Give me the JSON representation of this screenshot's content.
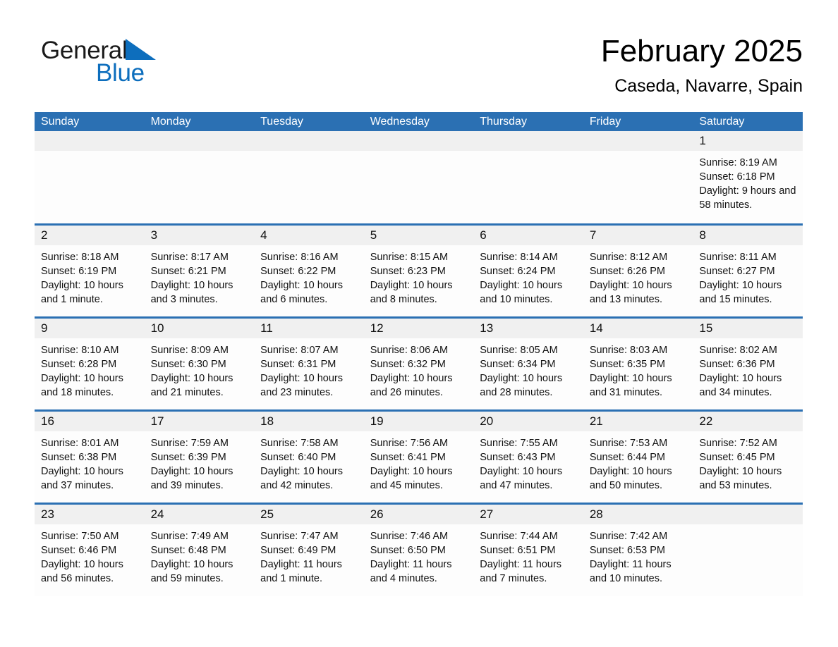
{
  "brand": {
    "word1": "General",
    "word2": "Blue",
    "flag_icon": "blue-triangle-flag",
    "accent_color": "#0d6ebd"
  },
  "header": {
    "title": "February 2025",
    "subtitle": "Caseda, Navarre, Spain"
  },
  "theme": {
    "header_blue": "#2b70b3",
    "day_band_gray": "#f0f0f0",
    "cell_white": "#fdfdfd",
    "text_black": "#111111"
  },
  "calendar": {
    "weekday_headers": [
      "Sunday",
      "Monday",
      "Tuesday",
      "Wednesday",
      "Thursday",
      "Friday",
      "Saturday"
    ],
    "weeks": [
      [
        {
          "day": "",
          "empty": true
        },
        {
          "day": "",
          "empty": true
        },
        {
          "day": "",
          "empty": true
        },
        {
          "day": "",
          "empty": true
        },
        {
          "day": "",
          "empty": true
        },
        {
          "day": "",
          "empty": true
        },
        {
          "day": "1",
          "sunrise": "Sunrise: 8:19 AM",
          "sunset": "Sunset: 6:18 PM",
          "daylight": "Daylight: 9 hours and 58 minutes."
        }
      ],
      [
        {
          "day": "2",
          "sunrise": "Sunrise: 8:18 AM",
          "sunset": "Sunset: 6:19 PM",
          "daylight": "Daylight: 10 hours and 1 minute."
        },
        {
          "day": "3",
          "sunrise": "Sunrise: 8:17 AM",
          "sunset": "Sunset: 6:21 PM",
          "daylight": "Daylight: 10 hours and 3 minutes."
        },
        {
          "day": "4",
          "sunrise": "Sunrise: 8:16 AM",
          "sunset": "Sunset: 6:22 PM",
          "daylight": "Daylight: 10 hours and 6 minutes."
        },
        {
          "day": "5",
          "sunrise": "Sunrise: 8:15 AM",
          "sunset": "Sunset: 6:23 PM",
          "daylight": "Daylight: 10 hours and 8 minutes."
        },
        {
          "day": "6",
          "sunrise": "Sunrise: 8:14 AM",
          "sunset": "Sunset: 6:24 PM",
          "daylight": "Daylight: 10 hours and 10 minutes."
        },
        {
          "day": "7",
          "sunrise": "Sunrise: 8:12 AM",
          "sunset": "Sunset: 6:26 PM",
          "daylight": "Daylight: 10 hours and 13 minutes."
        },
        {
          "day": "8",
          "sunrise": "Sunrise: 8:11 AM",
          "sunset": "Sunset: 6:27 PM",
          "daylight": "Daylight: 10 hours and 15 minutes."
        }
      ],
      [
        {
          "day": "9",
          "sunrise": "Sunrise: 8:10 AM",
          "sunset": "Sunset: 6:28 PM",
          "daylight": "Daylight: 10 hours and 18 minutes."
        },
        {
          "day": "10",
          "sunrise": "Sunrise: 8:09 AM",
          "sunset": "Sunset: 6:30 PM",
          "daylight": "Daylight: 10 hours and 21 minutes."
        },
        {
          "day": "11",
          "sunrise": "Sunrise: 8:07 AM",
          "sunset": "Sunset: 6:31 PM",
          "daylight": "Daylight: 10 hours and 23 minutes."
        },
        {
          "day": "12",
          "sunrise": "Sunrise: 8:06 AM",
          "sunset": "Sunset: 6:32 PM",
          "daylight": "Daylight: 10 hours and 26 minutes."
        },
        {
          "day": "13",
          "sunrise": "Sunrise: 8:05 AM",
          "sunset": "Sunset: 6:34 PM",
          "daylight": "Daylight: 10 hours and 28 minutes."
        },
        {
          "day": "14",
          "sunrise": "Sunrise: 8:03 AM",
          "sunset": "Sunset: 6:35 PM",
          "daylight": "Daylight: 10 hours and 31 minutes."
        },
        {
          "day": "15",
          "sunrise": "Sunrise: 8:02 AM",
          "sunset": "Sunset: 6:36 PM",
          "daylight": "Daylight: 10 hours and 34 minutes."
        }
      ],
      [
        {
          "day": "16",
          "sunrise": "Sunrise: 8:01 AM",
          "sunset": "Sunset: 6:38 PM",
          "daylight": "Daylight: 10 hours and 37 minutes."
        },
        {
          "day": "17",
          "sunrise": "Sunrise: 7:59 AM",
          "sunset": "Sunset: 6:39 PM",
          "daylight": "Daylight: 10 hours and 39 minutes."
        },
        {
          "day": "18",
          "sunrise": "Sunrise: 7:58 AM",
          "sunset": "Sunset: 6:40 PM",
          "daylight": "Daylight: 10 hours and 42 minutes."
        },
        {
          "day": "19",
          "sunrise": "Sunrise: 7:56 AM",
          "sunset": "Sunset: 6:41 PM",
          "daylight": "Daylight: 10 hours and 45 minutes."
        },
        {
          "day": "20",
          "sunrise": "Sunrise: 7:55 AM",
          "sunset": "Sunset: 6:43 PM",
          "daylight": "Daylight: 10 hours and 47 minutes."
        },
        {
          "day": "21",
          "sunrise": "Sunrise: 7:53 AM",
          "sunset": "Sunset: 6:44 PM",
          "daylight": "Daylight: 10 hours and 50 minutes."
        },
        {
          "day": "22",
          "sunrise": "Sunrise: 7:52 AM",
          "sunset": "Sunset: 6:45 PM",
          "daylight": "Daylight: 10 hours and 53 minutes."
        }
      ],
      [
        {
          "day": "23",
          "sunrise": "Sunrise: 7:50 AM",
          "sunset": "Sunset: 6:46 PM",
          "daylight": "Daylight: 10 hours and 56 minutes."
        },
        {
          "day": "24",
          "sunrise": "Sunrise: 7:49 AM",
          "sunset": "Sunset: 6:48 PM",
          "daylight": "Daylight: 10 hours and 59 minutes."
        },
        {
          "day": "25",
          "sunrise": "Sunrise: 7:47 AM",
          "sunset": "Sunset: 6:49 PM",
          "daylight": "Daylight: 11 hours and 1 minute."
        },
        {
          "day": "26",
          "sunrise": "Sunrise: 7:46 AM",
          "sunset": "Sunset: 6:50 PM",
          "daylight": "Daylight: 11 hours and 4 minutes."
        },
        {
          "day": "27",
          "sunrise": "Sunrise: 7:44 AM",
          "sunset": "Sunset: 6:51 PM",
          "daylight": "Daylight: 11 hours and 7 minutes."
        },
        {
          "day": "28",
          "sunrise": "Sunrise: 7:42 AM",
          "sunset": "Sunset: 6:53 PM",
          "daylight": "Daylight: 11 hours and 10 minutes."
        },
        {
          "day": "",
          "empty": true
        }
      ]
    ]
  }
}
